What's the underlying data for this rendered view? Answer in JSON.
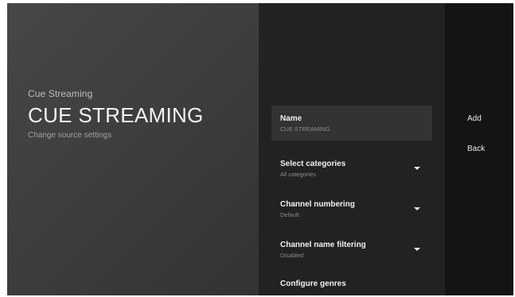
{
  "header": {
    "source_name": "Cue Streaming",
    "title": "CUE STREAMING",
    "subtitle": "Change source settings"
  },
  "settings": [
    {
      "label": "Name",
      "value": "CUE STREAMING",
      "icon": ""
    },
    {
      "label": "Select categories",
      "value": "All categories",
      "icon": "dropdown-arrow-icon"
    },
    {
      "label": "Channel numbering",
      "value": "Default",
      "icon": "dropdown-arrow-icon"
    },
    {
      "label": "Channel name filtering",
      "value": "Disabled",
      "icon": "dropdown-arrow-icon"
    },
    {
      "label": "Configure genres",
      "value": "",
      "icon": ""
    }
  ],
  "actions": {
    "add_label": "Add",
    "back_label": "Back"
  },
  "colors": {
    "left_panel_bg": "#424241",
    "middle_panel_bg": "#222222",
    "right_panel_bg": "#141414",
    "focused_item_bg": "#333333"
  }
}
